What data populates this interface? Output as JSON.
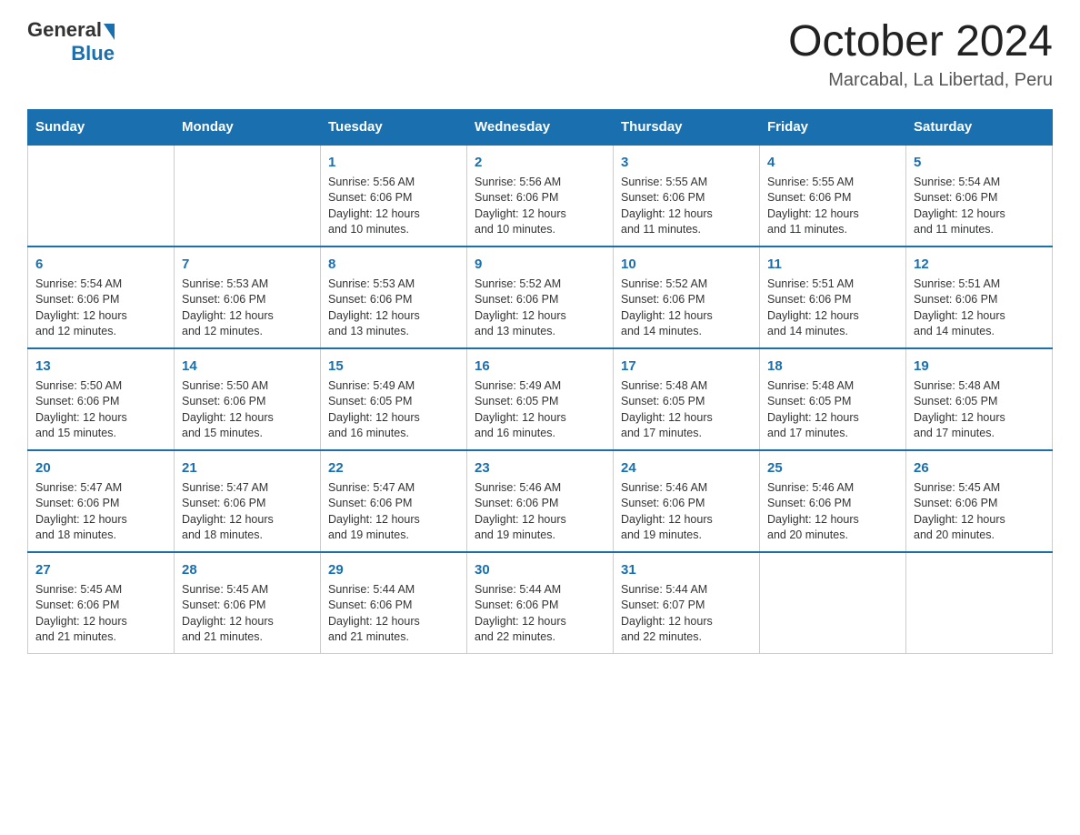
{
  "header": {
    "logo_general": "General",
    "logo_blue": "Blue",
    "month_title": "October 2024",
    "location": "Marcabal, La Libertad, Peru"
  },
  "weekdays": [
    "Sunday",
    "Monday",
    "Tuesday",
    "Wednesday",
    "Thursday",
    "Friday",
    "Saturday"
  ],
  "weeks": [
    [
      {
        "day": "",
        "info": ""
      },
      {
        "day": "",
        "info": ""
      },
      {
        "day": "1",
        "info": "Sunrise: 5:56 AM\nSunset: 6:06 PM\nDaylight: 12 hours\nand 10 minutes."
      },
      {
        "day": "2",
        "info": "Sunrise: 5:56 AM\nSunset: 6:06 PM\nDaylight: 12 hours\nand 10 minutes."
      },
      {
        "day": "3",
        "info": "Sunrise: 5:55 AM\nSunset: 6:06 PM\nDaylight: 12 hours\nand 11 minutes."
      },
      {
        "day": "4",
        "info": "Sunrise: 5:55 AM\nSunset: 6:06 PM\nDaylight: 12 hours\nand 11 minutes."
      },
      {
        "day": "5",
        "info": "Sunrise: 5:54 AM\nSunset: 6:06 PM\nDaylight: 12 hours\nand 11 minutes."
      }
    ],
    [
      {
        "day": "6",
        "info": "Sunrise: 5:54 AM\nSunset: 6:06 PM\nDaylight: 12 hours\nand 12 minutes."
      },
      {
        "day": "7",
        "info": "Sunrise: 5:53 AM\nSunset: 6:06 PM\nDaylight: 12 hours\nand 12 minutes."
      },
      {
        "day": "8",
        "info": "Sunrise: 5:53 AM\nSunset: 6:06 PM\nDaylight: 12 hours\nand 13 minutes."
      },
      {
        "day": "9",
        "info": "Sunrise: 5:52 AM\nSunset: 6:06 PM\nDaylight: 12 hours\nand 13 minutes."
      },
      {
        "day": "10",
        "info": "Sunrise: 5:52 AM\nSunset: 6:06 PM\nDaylight: 12 hours\nand 14 minutes."
      },
      {
        "day": "11",
        "info": "Sunrise: 5:51 AM\nSunset: 6:06 PM\nDaylight: 12 hours\nand 14 minutes."
      },
      {
        "day": "12",
        "info": "Sunrise: 5:51 AM\nSunset: 6:06 PM\nDaylight: 12 hours\nand 14 minutes."
      }
    ],
    [
      {
        "day": "13",
        "info": "Sunrise: 5:50 AM\nSunset: 6:06 PM\nDaylight: 12 hours\nand 15 minutes."
      },
      {
        "day": "14",
        "info": "Sunrise: 5:50 AM\nSunset: 6:06 PM\nDaylight: 12 hours\nand 15 minutes."
      },
      {
        "day": "15",
        "info": "Sunrise: 5:49 AM\nSunset: 6:05 PM\nDaylight: 12 hours\nand 16 minutes."
      },
      {
        "day": "16",
        "info": "Sunrise: 5:49 AM\nSunset: 6:05 PM\nDaylight: 12 hours\nand 16 minutes."
      },
      {
        "day": "17",
        "info": "Sunrise: 5:48 AM\nSunset: 6:05 PM\nDaylight: 12 hours\nand 17 minutes."
      },
      {
        "day": "18",
        "info": "Sunrise: 5:48 AM\nSunset: 6:05 PM\nDaylight: 12 hours\nand 17 minutes."
      },
      {
        "day": "19",
        "info": "Sunrise: 5:48 AM\nSunset: 6:05 PM\nDaylight: 12 hours\nand 17 minutes."
      }
    ],
    [
      {
        "day": "20",
        "info": "Sunrise: 5:47 AM\nSunset: 6:06 PM\nDaylight: 12 hours\nand 18 minutes."
      },
      {
        "day": "21",
        "info": "Sunrise: 5:47 AM\nSunset: 6:06 PM\nDaylight: 12 hours\nand 18 minutes."
      },
      {
        "day": "22",
        "info": "Sunrise: 5:47 AM\nSunset: 6:06 PM\nDaylight: 12 hours\nand 19 minutes."
      },
      {
        "day": "23",
        "info": "Sunrise: 5:46 AM\nSunset: 6:06 PM\nDaylight: 12 hours\nand 19 minutes."
      },
      {
        "day": "24",
        "info": "Sunrise: 5:46 AM\nSunset: 6:06 PM\nDaylight: 12 hours\nand 19 minutes."
      },
      {
        "day": "25",
        "info": "Sunrise: 5:46 AM\nSunset: 6:06 PM\nDaylight: 12 hours\nand 20 minutes."
      },
      {
        "day": "26",
        "info": "Sunrise: 5:45 AM\nSunset: 6:06 PM\nDaylight: 12 hours\nand 20 minutes."
      }
    ],
    [
      {
        "day": "27",
        "info": "Sunrise: 5:45 AM\nSunset: 6:06 PM\nDaylight: 12 hours\nand 21 minutes."
      },
      {
        "day": "28",
        "info": "Sunrise: 5:45 AM\nSunset: 6:06 PM\nDaylight: 12 hours\nand 21 minutes."
      },
      {
        "day": "29",
        "info": "Sunrise: 5:44 AM\nSunset: 6:06 PM\nDaylight: 12 hours\nand 21 minutes."
      },
      {
        "day": "30",
        "info": "Sunrise: 5:44 AM\nSunset: 6:06 PM\nDaylight: 12 hours\nand 22 minutes."
      },
      {
        "day": "31",
        "info": "Sunrise: 5:44 AM\nSunset: 6:07 PM\nDaylight: 12 hours\nand 22 minutes."
      },
      {
        "day": "",
        "info": ""
      },
      {
        "day": "",
        "info": ""
      }
    ]
  ]
}
